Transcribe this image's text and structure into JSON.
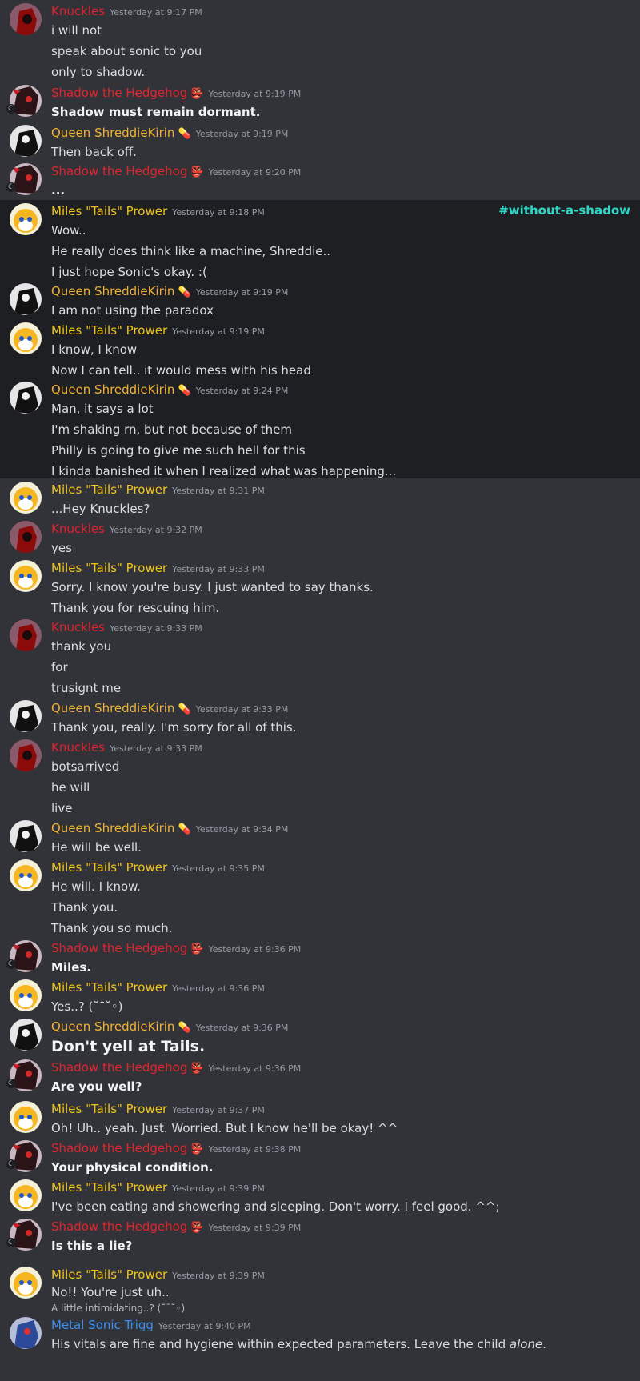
{
  "channel_tag": "#without-a-shadow",
  "messages": [
    {
      "author": "Knuckles",
      "ts": "Yesterday at 9:17 PM",
      "lines": [
        "i will not",
        "speak about sonic to you",
        "only to shadow."
      ]
    },
    {
      "author": "Shadow the Hedgehog",
      "ts": "Yesterday at 9:19 PM",
      "lines": [
        "Shadow must remain dormant."
      ]
    },
    {
      "author": "Queen ShreddieKirin",
      "ts": "Yesterday at 9:19 PM",
      "lines": [
        "Then back off."
      ]
    },
    {
      "author": "Shadow the Hedgehog",
      "ts": "Yesterday at 9:20 PM",
      "lines": [
        "..."
      ]
    },
    {
      "author": "Miles \"Tails\" Prower",
      "ts": "Yesterday at 9:18 PM",
      "lines": [
        "Wow..",
        "He really does think like a machine, Shreddie..",
        "I just hope Sonic's okay. :("
      ]
    },
    {
      "author": "Queen ShreddieKirin",
      "ts": "Yesterday at 9:19 PM",
      "lines": [
        "I am not using the paradox"
      ]
    },
    {
      "author": "Miles \"Tails\" Prower",
      "ts": "Yesterday at 9:19 PM",
      "lines": [
        "I know, I know",
        "Now I can tell.. it would mess with his head"
      ]
    },
    {
      "author": "Queen ShreddieKirin",
      "ts": "Yesterday at 9:24 PM",
      "lines": [
        "Man, it says a lot",
        "I'm shaking rn, but not because of them",
        "Philly is going to give me such hell for this",
        "I kinda banished it when I realized what was happening..."
      ]
    },
    {
      "author": "Miles \"Tails\" Prower",
      "ts": "Yesterday at 9:31 PM",
      "lines": [
        "...Hey Knuckles?"
      ]
    },
    {
      "author": "Knuckles",
      "ts": "Yesterday at 9:32 PM",
      "lines": [
        "yes"
      ]
    },
    {
      "author": "Miles \"Tails\" Prower",
      "ts": "Yesterday at 9:33 PM",
      "lines": [
        "Sorry. I know you're busy. I just wanted to say thanks.",
        "Thank you for rescuing him."
      ]
    },
    {
      "author": "Knuckles",
      "ts": "Yesterday at 9:33 PM",
      "lines": [
        "thank you",
        "for",
        "trusignt me"
      ]
    },
    {
      "author": "Queen ShreddieKirin",
      "ts": "Yesterday at 9:33 PM",
      "lines": [
        "Thank you, really. I'm sorry for all of this."
      ]
    },
    {
      "author": "Knuckles",
      "ts": "Yesterday at 9:33 PM",
      "lines": [
        "botsarrived",
        "he will",
        "live"
      ]
    },
    {
      "author": "Queen ShreddieKirin",
      "ts": "Yesterday at 9:34 PM",
      "lines": [
        "He will be well."
      ]
    },
    {
      "author": "Miles \"Tails\" Prower",
      "ts": "Yesterday at 9:35 PM",
      "lines": [
        "He will. I know.",
        "Thank you.",
        "Thank you so much."
      ]
    },
    {
      "author": "Shadow the Hedgehog",
      "ts": "Yesterday at 9:36 PM",
      "lines": [
        "Miles."
      ]
    },
    {
      "author": "Miles \"Tails\" Prower",
      "ts": "Yesterday at 9:36 PM",
      "lines": [
        "Yes..? (˘¯˘◦)"
      ]
    },
    {
      "author": "Queen ShreddieKirin",
      "ts": "Yesterday at 9:36 PM",
      "lines": [
        "Don't yell at Tails."
      ]
    },
    {
      "author": "Shadow the Hedgehog",
      "ts": "Yesterday at 9:36 PM",
      "lines": [
        "Are you well?"
      ]
    },
    {
      "author": "Miles \"Tails\" Prower",
      "ts": "Yesterday at 9:37 PM",
      "lines": [
        "Oh! Uh.. yeah. Just. Worried. But I know he'll be okay! ^^"
      ]
    },
    {
      "author": "Shadow the Hedgehog",
      "ts": "Yesterday at 9:38 PM",
      "lines": [
        "Your physical condition."
      ]
    },
    {
      "author": "Miles \"Tails\" Prower",
      "ts": "Yesterday at 9:39 PM",
      "lines": [
        "I've been eating and showering and sleeping. Don't worry. I feel good. ^^;"
      ]
    },
    {
      "author": "Shadow the Hedgehog",
      "ts": "Yesterday at 9:39 PM",
      "lines": [
        "Is this a lie?"
      ]
    },
    {
      "author": "Miles \"Tails\" Prower",
      "ts": "Yesterday at 9:39 PM",
      "lines": [
        "No!! You're just uh..",
        "A little intimidating..? (˘¯˘◦)"
      ]
    },
    {
      "author": "Metal Sonic Trigg",
      "ts": "Yesterday at 9:40 PM",
      "lines": [
        "His vitals are fine and hygiene within expected parameters. Leave the child ",
        "alone",
        "."
      ]
    }
  ]
}
